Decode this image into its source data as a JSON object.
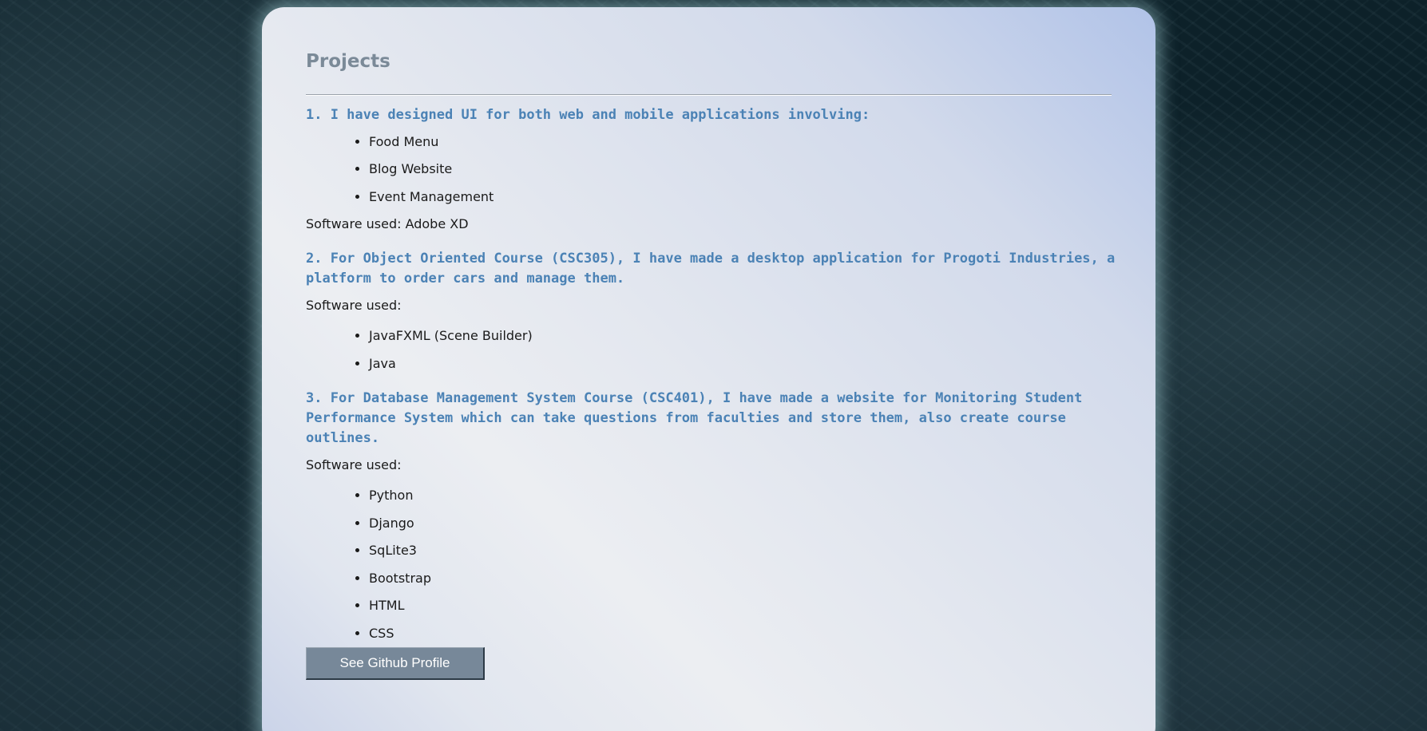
{
  "section": {
    "title": "Projects"
  },
  "projects": [
    {
      "heading": "1. I have designed UI for both web and mobile applications involving:",
      "items": [
        "Food Menu",
        "Blog Website",
        "Event Management"
      ],
      "software": "Software used: Adobe XD"
    },
    {
      "heading": "2. For Object Oriented Course (CSC305), I have made a desktop application for Progoti Industries, a platform to order cars and manage them.",
      "software": "Software used:",
      "items": [
        "JavaFXML (Scene Builder)",
        "Java"
      ]
    },
    {
      "heading": "3. For Database Management System Course (CSC401), I have made a website for Monitoring Student Performance System which can take questions from faculties and store them, also create course outlines.",
      "software": "Software used:",
      "items": [
        "Python",
        "Django",
        "SqLite3",
        "Bootstrap",
        "HTML",
        "CSS"
      ]
    }
  ],
  "actions": {
    "github_label": "See Github Profile"
  },
  "colors": {
    "heading": "#4b82b5",
    "title": "#7b8a98",
    "button": "#778899"
  }
}
